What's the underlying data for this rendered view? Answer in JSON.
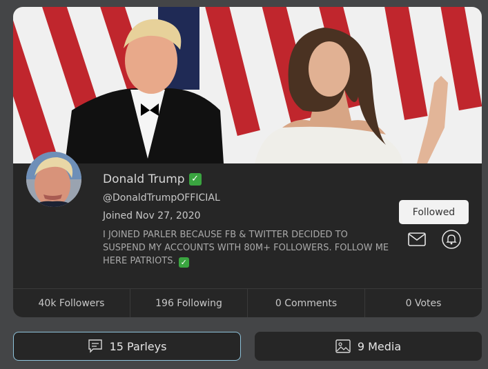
{
  "profile": {
    "name": "Donald Trump",
    "handle": "@DonaldTrumpOFFICIAL",
    "joined": "Joined Nov 27, 2020",
    "bio": "I JOINED PARLER BECAUSE FB & TWITTER DECIDED TO SUSPEND MY ACCOUNTS WITH 80M+ FOLLOWERS. FOLLOW ME HERE PATRIOTS.",
    "verified_icon": "check-mark-icon"
  },
  "actions": {
    "followed_label": "Followed",
    "message_icon": "envelope-icon",
    "notify_icon": "bell-icon"
  },
  "stats": [
    {
      "label": "40k Followers"
    },
    {
      "label": "196 Following"
    },
    {
      "label": "0 Comments"
    },
    {
      "label": "0 Votes"
    }
  ],
  "tabs": [
    {
      "label": "15 Parleys",
      "icon": "chat-icon",
      "active": true
    },
    {
      "label": "9 Media",
      "icon": "image-icon",
      "active": false
    }
  ],
  "colors": {
    "background": "#444547",
    "card": "#262626",
    "active_border": "#8fc4dc",
    "verified": "#3aa540"
  }
}
